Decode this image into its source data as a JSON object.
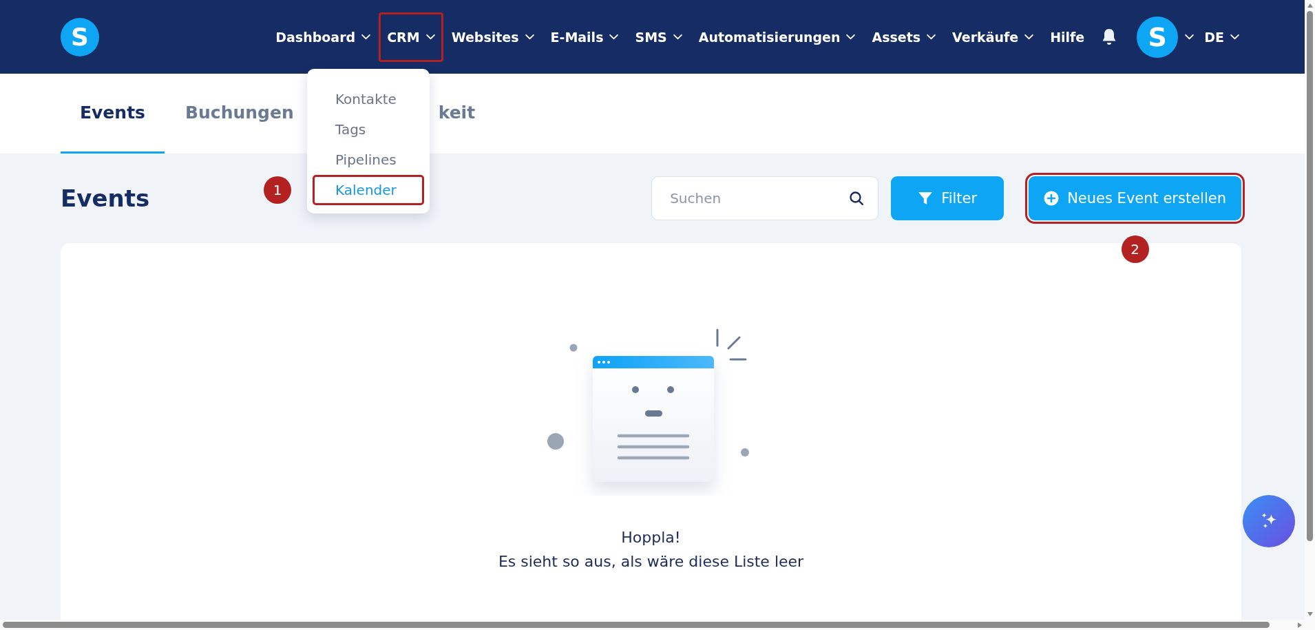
{
  "header": {
    "logo": "S",
    "nav": [
      {
        "label": "Dashboard",
        "dropdown": true,
        "highlighted": false
      },
      {
        "label": "CRM",
        "dropdown": true,
        "highlighted": true
      },
      {
        "label": "Websites",
        "dropdown": true,
        "highlighted": false
      },
      {
        "label": "E-Mails",
        "dropdown": true,
        "highlighted": false
      },
      {
        "label": "SMS",
        "dropdown": true,
        "highlighted": false
      },
      {
        "label": "Automatisierungen",
        "dropdown": true,
        "highlighted": false
      },
      {
        "label": "Assets",
        "dropdown": true,
        "highlighted": false
      },
      {
        "label": "Verkäufe",
        "dropdown": true,
        "highlighted": false
      },
      {
        "label": "Hilfe",
        "dropdown": false,
        "highlighted": false
      }
    ],
    "avatar": "S",
    "language": "DE"
  },
  "crm_menu": [
    {
      "label": "Kontakte",
      "selected": false,
      "highlighted": false
    },
    {
      "label": "Tags",
      "selected": false,
      "highlighted": false
    },
    {
      "label": "Pipelines",
      "selected": false,
      "highlighted": false
    },
    {
      "label": "Kalender",
      "selected": true,
      "highlighted": true,
      "marker": "1"
    }
  ],
  "tabs": [
    {
      "label": "Events",
      "selected": true
    },
    {
      "label": "Buchungen",
      "selected": false
    },
    {
      "label": "keit",
      "selected": false
    }
  ],
  "page_title": "Events",
  "search": {
    "placeholder": "Suchen"
  },
  "filter_button": "Filter",
  "create_button": {
    "label": "Neues Event erstellen",
    "highlighted": true,
    "marker": "2"
  },
  "empty_state": {
    "title": "Hoppla!",
    "message": "Es sieht so aus, als wäre diese Liste leer"
  }
}
